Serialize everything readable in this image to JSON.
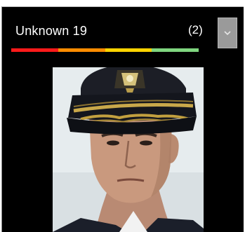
{
  "card": {
    "name": "Unknown 19",
    "count": "(2)"
  },
  "dropdown": {
    "icon": "chevron-down-icon"
  },
  "quality_bar": {
    "segments": [
      "#ff1a1a",
      "#ff8c00",
      "#ffd400",
      "#7fd67f"
    ]
  },
  "photo": {
    "icon": "face-thumbnail"
  },
  "colors": {
    "background": "#000000",
    "text": "#ffffff",
    "dropdown_bg": "#9a9a9a"
  }
}
